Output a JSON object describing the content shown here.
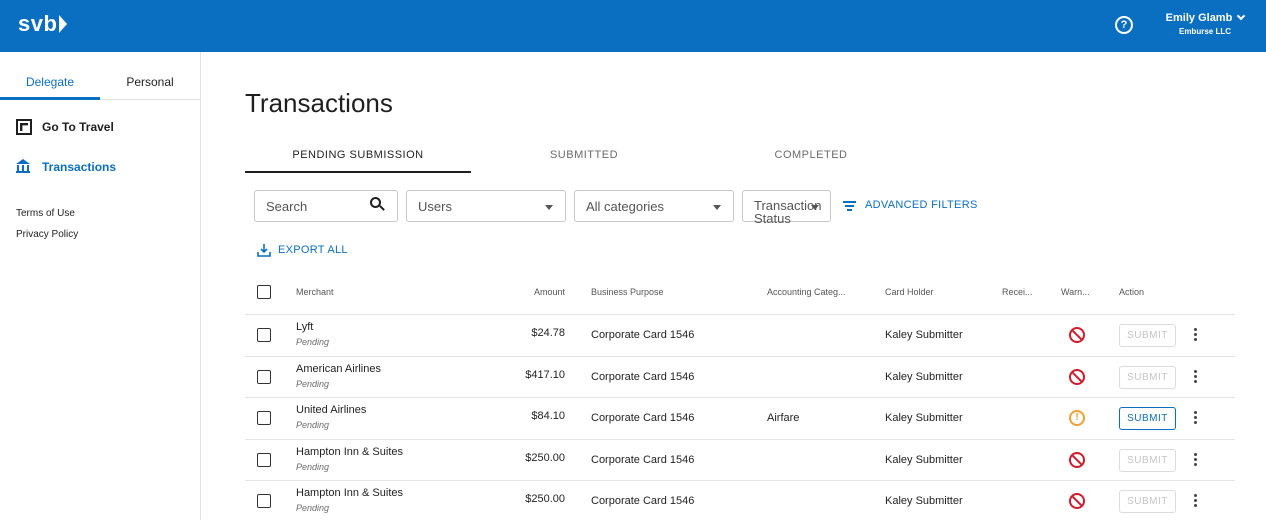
{
  "header": {
    "logo": "svb",
    "help_icon": "question-circle-icon",
    "user_name": "Emily Glamb",
    "user_org": "Emburse LLC"
  },
  "sidebar": {
    "tabs": [
      "Delegate",
      "Personal"
    ],
    "active_tab": "Delegate",
    "nav": [
      {
        "label": "Go To Travel",
        "icon": "external-link-icon"
      },
      {
        "label": "Transactions",
        "icon": "bank-icon"
      }
    ],
    "links": [
      "Terms of Use",
      "Privacy Policy"
    ]
  },
  "main": {
    "title": "Transactions",
    "tabs": [
      "PENDING SUBMISSION",
      "SUBMITTED",
      "COMPLETED"
    ],
    "active_tab": "PENDING SUBMISSION",
    "filters": {
      "search_placeholder": "Search",
      "users": "Users",
      "categories": "All categories",
      "status": "Transaction Status",
      "advanced": "ADVANCED FILTERS"
    },
    "export_all": "EXPORT ALL"
  },
  "table": {
    "columns": [
      "Merchant",
      "Amount",
      "Business Purpose",
      "Accounting Categ...",
      "Card Holder",
      "Recei...",
      "Warn...",
      "Action"
    ],
    "rows": [
      {
        "merchant": "Lyft",
        "status": "Pending",
        "amount": "$24.78",
        "purpose": "Corporate Card 1546",
        "category": "",
        "holder": "Kaley Submitter",
        "warning": "ban",
        "action": "SUBMIT",
        "action_enabled": false
      },
      {
        "merchant": "American Airlines",
        "status": "Pending",
        "amount": "$417.10",
        "purpose": "Corporate Card 1546",
        "category": "",
        "holder": "Kaley Submitter",
        "warning": "ban",
        "action": "SUBMIT",
        "action_enabled": false
      },
      {
        "merchant": "United Airlines",
        "status": "Pending",
        "amount": "$84.10",
        "purpose": "Corporate Card 1546",
        "category": "Airfare",
        "holder": "Kaley Submitter",
        "warning": "alert",
        "action": "SUBMIT",
        "action_enabled": true
      },
      {
        "merchant": "Hampton Inn & Suites",
        "status": "Pending",
        "amount": "$250.00",
        "purpose": "Corporate Card 1546",
        "category": "",
        "holder": "Kaley Submitter",
        "warning": "ban",
        "action": "SUBMIT",
        "action_enabled": false
      },
      {
        "merchant": "Hampton Inn & Suites",
        "status": "Pending",
        "amount": "$250.00",
        "purpose": "Corporate Card 1546",
        "category": "",
        "holder": "Kaley Submitter",
        "warning": "ban",
        "action": "SUBMIT",
        "action_enabled": false
      }
    ]
  },
  "colors": {
    "brand": "#0a6fc0",
    "danger": "#d11b2a",
    "warning": "#f0a030"
  }
}
